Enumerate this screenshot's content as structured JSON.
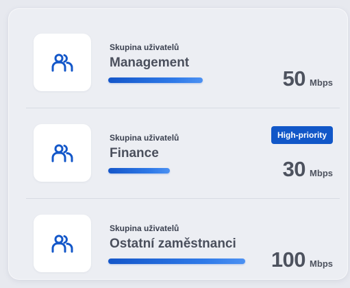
{
  "colors": {
    "accent": "#1157c8",
    "bar_gradient_start": "#1456c9",
    "bar_gradient_end": "#4c91f2",
    "card_background": "#eceef3",
    "icon_color": "#1357c9"
  },
  "groups": [
    {
      "label": "Skupina uživatelů",
      "name": "Management",
      "bandwidth_value": "50",
      "bandwidth_unit": "Mbps",
      "bar_level": 0.6,
      "badge": null,
      "icon": "users-icon"
    },
    {
      "label": "Skupina uživatelů",
      "name": "Finance",
      "bandwidth_value": "30",
      "bandwidth_unit": "Mbps",
      "bar_level": 0.39,
      "badge": "High-priority",
      "icon": "users-icon"
    },
    {
      "label": "Skupina uživatelů",
      "name": "Ostatní zaměstnanci",
      "bandwidth_value": "100",
      "bandwidth_unit": "Mbps",
      "bar_level": 0.87,
      "badge": null,
      "icon": "users-icon"
    }
  ]
}
